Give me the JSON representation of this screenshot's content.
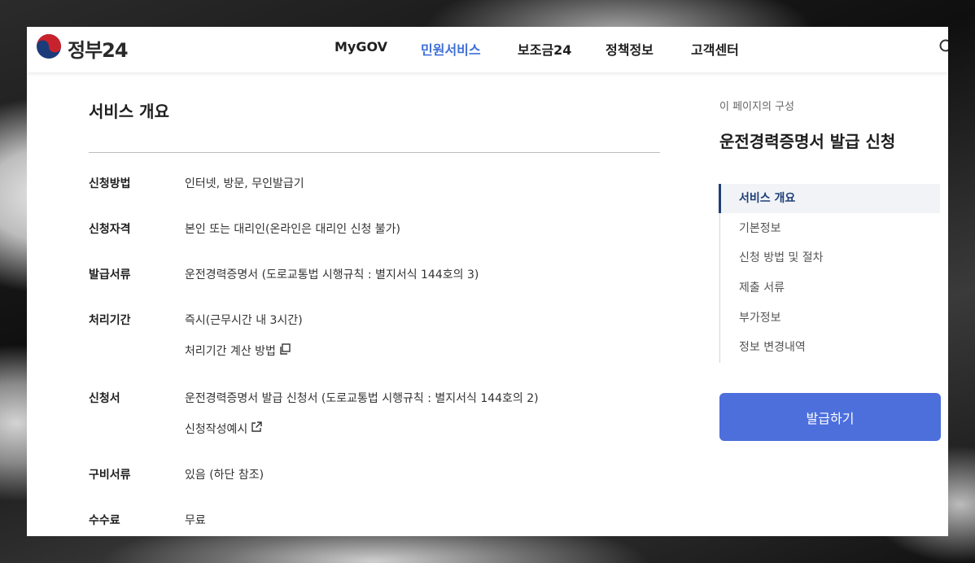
{
  "header": {
    "logo_text": "정부24",
    "nav": [
      "MyGOV",
      "민원서비스",
      "보조금24",
      "정책정보",
      "고객센터"
    ],
    "active_nav": "민원서비스"
  },
  "main": {
    "title": "서비스 개요",
    "rows": [
      {
        "label": "신청방법",
        "value": "인터넷, 방문, 무인발급기"
      },
      {
        "label": "신청자격",
        "value": "본인 또는 대리인(온라인은 대리인 신청 불가)"
      },
      {
        "label": "발급서류",
        "value": "운전경력증명서 (도로교통법 시행규칙 : 별지서식 144호의 3)"
      },
      {
        "label": "처리기간",
        "value": "즉시(근무시간 내 3시간)",
        "link": "처리기간 계산 방법"
      },
      {
        "label": "신청서",
        "value": "운전경력증명서 발급 신청서 (도로교통법 시행규칙 : 별지서식 144호의 2)",
        "link": "신청작성예시"
      },
      {
        "label": "구비서류",
        "value": "있음 (하단 참조)"
      },
      {
        "label": "수수료",
        "value": "무료"
      }
    ]
  },
  "sidebar": {
    "caption": "이 페이지의 구성",
    "title": "운전경력증명서 발급 신청",
    "toc": [
      "서비스 개요",
      "기본정보",
      "신청 방법 및 절차",
      "제출 서류",
      "부가정보",
      "정보 변경내역"
    ],
    "active_toc": "서비스 개요",
    "button_label": "발급하기"
  },
  "colors": {
    "accent": "#4d6fdc",
    "nav_active": "#3f6fd8",
    "toc_active": "#1f3f78"
  },
  "icons": {
    "logo": "taegeuk-icon",
    "search": "search-icon",
    "copy": "copy-icon",
    "external_link": "external-link-icon"
  }
}
